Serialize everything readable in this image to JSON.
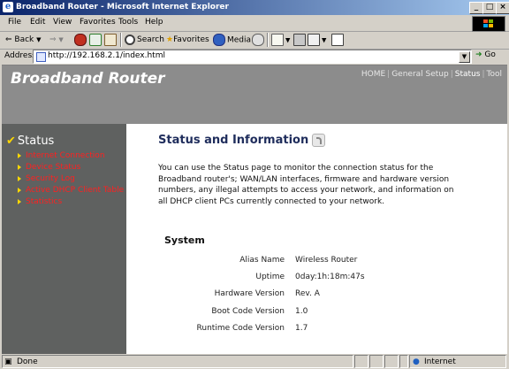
{
  "window": {
    "title": "Broadband Router - Microsoft Internet Explorer",
    "minimize_glyph": "_",
    "maximize_glyph": "□",
    "close_glyph": "×"
  },
  "menu": [
    "File",
    "Edit",
    "View",
    "Favorites",
    "Tools",
    "Help"
  ],
  "toolbar": {
    "back_label": "Back",
    "search_label": "Search",
    "favorites_label": "Favorites",
    "media_label": "Media"
  },
  "address": {
    "label": "Address",
    "url": "http://192.168.2.1/index.html",
    "go_label": "Go"
  },
  "page": {
    "brand": "Broadband Router",
    "topnav": [
      "HOME",
      "General Setup",
      "Status",
      "Tool"
    ],
    "topnav_active": "Status",
    "sidebar": {
      "heading": "Status",
      "items": [
        "Internet Connection",
        "Device Status",
        "Security Log",
        "Active DHCP Client Table",
        "Statistics"
      ]
    },
    "heading": "Status and Information",
    "intro": "You can use the Status page to monitor the connection status for the Broadband router's; WAN/LAN interfaces, firmware and hardware version numbers, any illegal attempts to access your network, and information on all DHCP client PCs currently connected to your network.",
    "system": {
      "title": "System",
      "rows": [
        {
          "label": "Alias Name",
          "value": "Wireless Router"
        },
        {
          "label": "Uptime",
          "value": "0day:1h:18m:47s"
        },
        {
          "label": "Hardware Version",
          "value": "Rev. A"
        },
        {
          "label": "Boot Code Version",
          "value": "1.0"
        },
        {
          "label": "Runtime Code Version",
          "value": "1.7"
        }
      ]
    }
  },
  "statusbar": {
    "text": "Done",
    "zone": "Internet"
  },
  "colors": {
    "header_bg": "#8c8c8c",
    "sidebar_bg": "#5f6160",
    "sidebar_link": "#ff2020",
    "heading": "#1f2d5c",
    "accent_bullet": "#ffd800"
  }
}
